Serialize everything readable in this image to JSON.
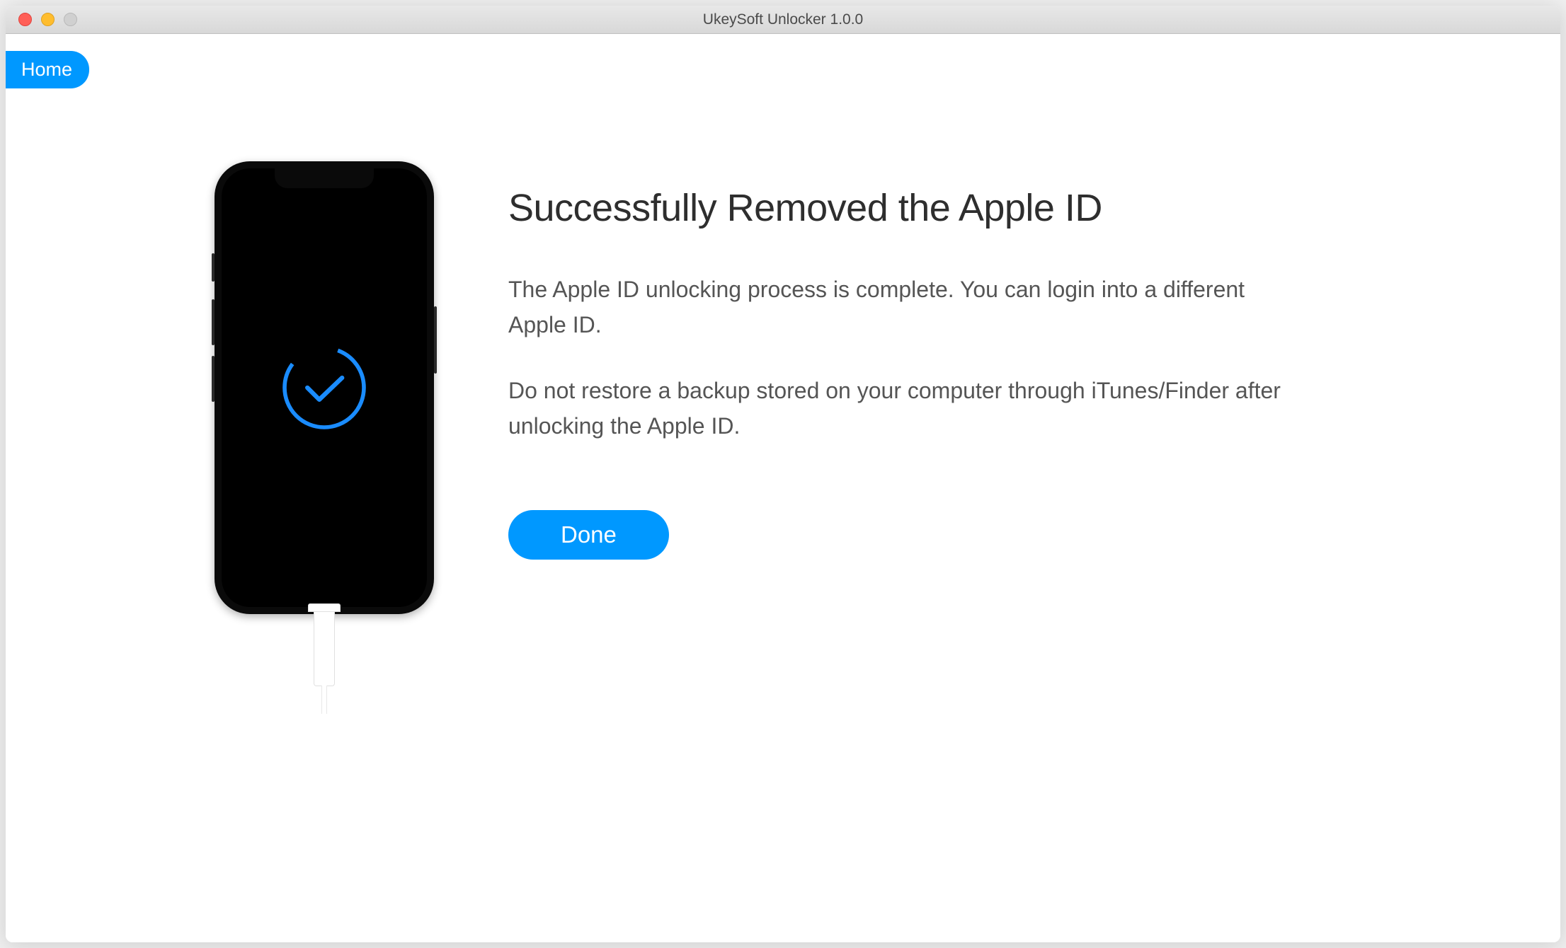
{
  "window": {
    "title": "UkeySoft Unlocker 1.0.0"
  },
  "nav": {
    "home_label": "Home"
  },
  "main": {
    "heading": "Successfully Removed the Apple ID",
    "paragraph1": "The Apple ID unlocking process is complete. You can login into a different Apple ID.",
    "paragraph2": "Do not restore a backup stored on your computer through iTunes/Finder after unlocking the Apple ID.",
    "done_label": "Done"
  },
  "colors": {
    "accent": "#0098ff"
  },
  "icons": {
    "phone_status": "success-checkmark-icon"
  }
}
